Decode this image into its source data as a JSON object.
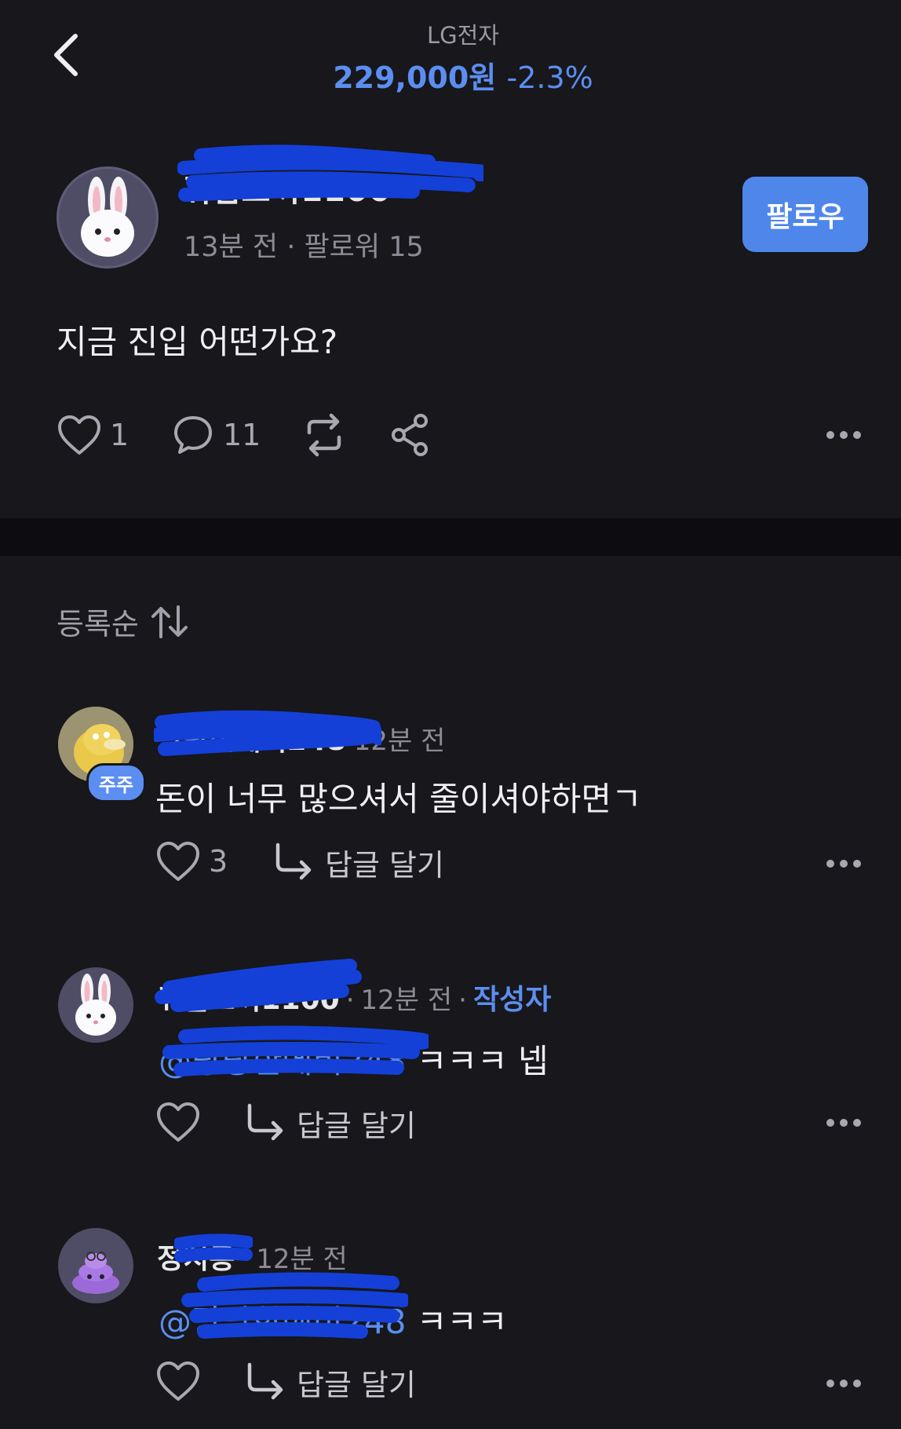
{
  "header": {
    "stock_name": "LG전자",
    "price": "229,000원",
    "change": "-2.3%"
  },
  "post": {
    "author_name": "귀염토끼1100",
    "time": "13분 전",
    "followers": "팔로워 15",
    "follow_label": "팔로우",
    "text": "지금 진입 어떤가요?",
    "like_count": "1",
    "comment_count": "11"
  },
  "sort": {
    "label": "등록순"
  },
  "comments": [
    {
      "name": "당당한에비248",
      "time": "12분 전",
      "badge": "주주",
      "text": "돈이 너무 많으셔서 줄이셔야하면ㄱ",
      "like_count": "3",
      "reply_label": "답글 달기"
    },
    {
      "name": "귀염토끼1100",
      "time": "12분 전",
      "author_tag": "작성자",
      "mention": "@당당한에비248",
      "text": "ㅋㅋㅋ 넵",
      "reply_label": "답글 달기"
    },
    {
      "name": "정치통",
      "time": "12분 전",
      "mention": "@당당한에비248",
      "text": "ㅋㅋㅋ",
      "reply_label": "답글 달기"
    }
  ],
  "colors": {
    "background": "#17171c",
    "accent": "#5b8ef0",
    "redaction": "#1440d8"
  },
  "icons": [
    "back-arrow-icon",
    "heart-icon",
    "comment-icon",
    "repost-icon",
    "share-icon",
    "more-icon",
    "sort-icon",
    "reply-arrow-icon"
  ]
}
